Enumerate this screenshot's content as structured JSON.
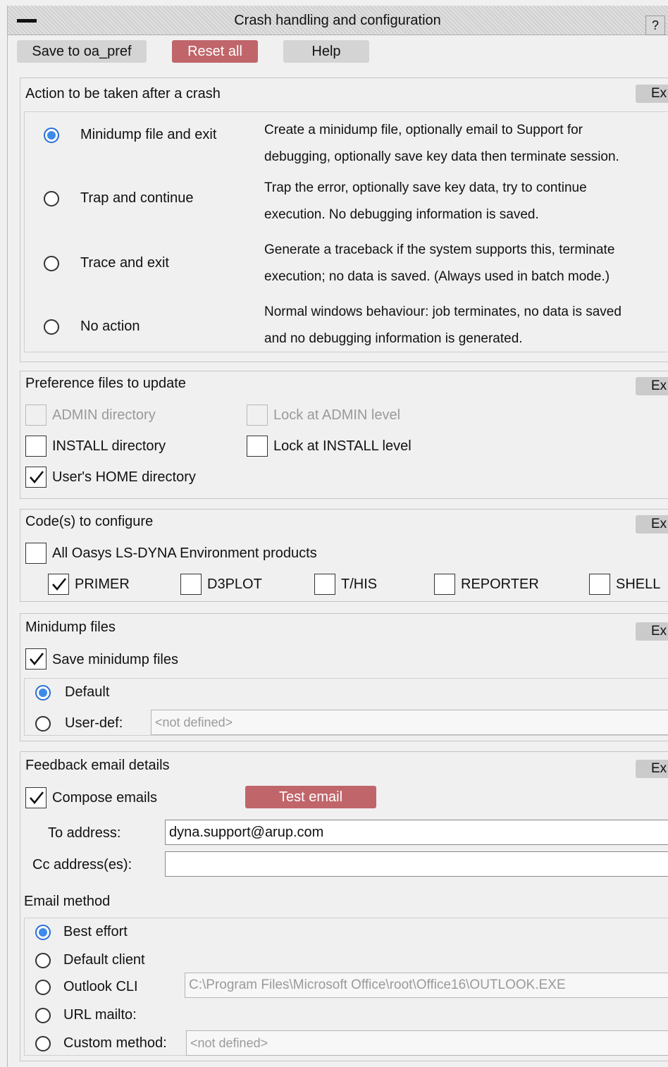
{
  "window": {
    "title": "Crash handling and configuration",
    "help_label": "?"
  },
  "toolbar": {
    "save_label": "Save to oa_pref",
    "reset_label": "Reset all",
    "help_label": "Help"
  },
  "crash_action": {
    "title": "Action to be taken after a crash",
    "ex_label": "Ex",
    "options": [
      {
        "label": "Minidump file and exit",
        "selected": true,
        "desc1": "Create a minidump file, optionally email to Support for",
        "desc2": "debugging, optionally save key data then terminate session."
      },
      {
        "label": "Trap and continue",
        "selected": false,
        "desc1": "Trap the error, optionally save key data, try to continue",
        "desc2": "execution. No debugging information is saved."
      },
      {
        "label": "Trace and exit",
        "selected": false,
        "desc1": "Generate a traceback if the system supports this, terminate",
        "desc2": "execution; no data is saved. (Always used in batch mode.)"
      },
      {
        "label": "No action",
        "selected": false,
        "desc1": "Normal windows behaviour: job terminates, no data is saved",
        "desc2": "and no debugging information is generated."
      }
    ]
  },
  "pref_files": {
    "title": "Preference files to update",
    "ex_label": "Ex",
    "admin_dir": "ADMIN directory",
    "lock_admin": "Lock at ADMIN level",
    "install_dir": "INSTALL directory",
    "lock_install": "Lock at INSTALL level",
    "home_dir": "User's HOME directory",
    "home_checked": true
  },
  "codes": {
    "title": "Code(s) to configure",
    "ex_label": "Ex",
    "all_label": "All Oasys LS-DYNA Environment products",
    "products": [
      {
        "label": "PRIMER",
        "checked": true
      },
      {
        "label": "D3PLOT",
        "checked": false
      },
      {
        "label": "T/HIS",
        "checked": false
      },
      {
        "label": "REPORTER",
        "checked": false
      },
      {
        "label": "SHELL",
        "checked": false
      }
    ]
  },
  "minidump": {
    "title": "Minidump files",
    "ex_label": "Ex",
    "save_label": "Save minidump files",
    "save_checked": true,
    "default_label": "Default",
    "userdef_label": "User-def:",
    "userdef_placeholder": "<not defined>"
  },
  "feedback": {
    "title": "Feedback email details",
    "ex_label": "Ex",
    "compose_label": "Compose emails",
    "compose_checked": true,
    "test_email_label": "Test email",
    "to_label": "To address:",
    "to_value": "dyna.support@arup.com",
    "cc_label": "Cc address(es):",
    "cc_value": "",
    "method_title": "Email method",
    "methods": {
      "best_effort": "Best effort",
      "default_client": "Default client",
      "outlook_cli": "Outlook CLI",
      "url_mailto": "URL mailto:",
      "custom_method": "Custom method:"
    },
    "outlook_path": "C:\\Program Files\\Microsoft Office\\root\\Office16\\OUTLOOK.EXE",
    "custom_placeholder": "<not defined>"
  }
}
